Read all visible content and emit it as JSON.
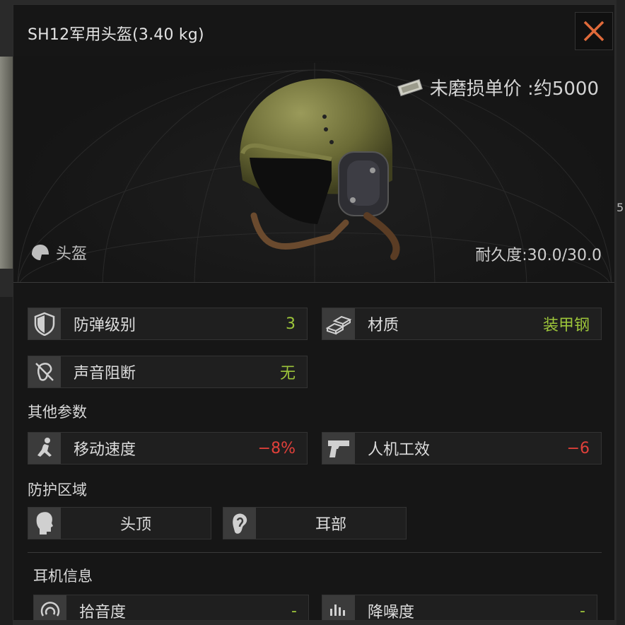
{
  "window": {
    "title": "SH12军用头盔(3.40 kg)",
    "close_icon": "close-icon",
    "accent": "#e06a3a"
  },
  "preview": {
    "price_label": "未磨损单价 :约5000",
    "category_label": "头盔",
    "durability_label": "耐久度:",
    "durability_value": "30.0/30.0"
  },
  "stats": [
    {
      "icon": "shield-icon",
      "label": "防弹级别",
      "value": "3",
      "color": "#9cc43a"
    },
    {
      "icon": "steel-bars-icon",
      "label": "材质",
      "value": "装甲钢",
      "color": "#9cc43a"
    },
    {
      "icon": "ear-muted-icon",
      "label": "声音阻断",
      "value": "无",
      "color": "#9cc43a"
    }
  ],
  "other_params": {
    "heading": "其他参数",
    "items": [
      {
        "icon": "running-icon",
        "label": "移动速度",
        "value": "−8%",
        "color": "#e0403a"
      },
      {
        "icon": "pistol-icon",
        "label": "人机工效",
        "value": "−6",
        "color": "#e0403a"
      }
    ]
  },
  "protection": {
    "heading": "防护区域",
    "zones": [
      {
        "icon": "head-icon",
        "label": "头顶"
      },
      {
        "icon": "ear-icon",
        "label": "耳部"
      }
    ]
  },
  "headset": {
    "heading": "耳机信息",
    "items": [
      {
        "icon": "sound-pickup-icon",
        "label": "拾音度",
        "value": "-"
      },
      {
        "icon": "noise-reduction-icon",
        "label": "降噪度",
        "value": "-"
      }
    ]
  },
  "background": {
    "right_fragment": "5"
  }
}
